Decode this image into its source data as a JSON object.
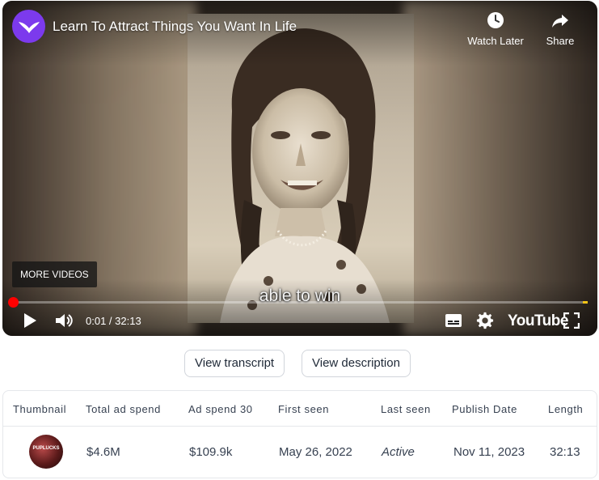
{
  "player": {
    "title": "Learn To Attract Things You Want In Life",
    "channel_icon": "wing-logo-icon",
    "watch_later_label": "Watch Later",
    "share_label": "Share",
    "more_videos_label": "MORE VIDEOS",
    "caption": "able to win",
    "time_current": "0:01",
    "time_separator": " / ",
    "time_total": "32:13",
    "time_readout": "0:01 / 32:13",
    "progress": 0.001,
    "logo_text": "YouTube",
    "colors": {
      "progress": "#ff0000",
      "ad_marker": "#f5c518",
      "channel": "#7c3aed"
    }
  },
  "actions": {
    "view_transcript": "View transcript",
    "view_description": "View description"
  },
  "table": {
    "headers": [
      "Thumbnail",
      "Total ad spend",
      "Ad spend 30",
      "First seen",
      "Last seen",
      "Publish Date",
      "Length"
    ],
    "row": {
      "thumbnail_text": "PUPLUCKS",
      "total_ad_spend": "$4.6M",
      "ad_spend_30": "$109.9k",
      "first_seen": "May 26, 2022",
      "last_seen": "Active",
      "publish_date": "Nov 11, 2023",
      "length": "32:13"
    }
  }
}
